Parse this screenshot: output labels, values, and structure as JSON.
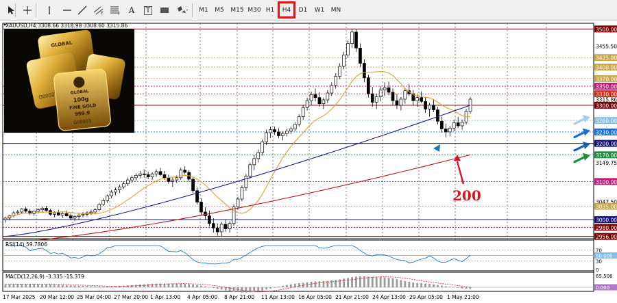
{
  "toolbar": {
    "tools": [
      {
        "name": "cursor-icon"
      },
      {
        "name": "crosshair-icon"
      },
      {
        "name": "vertical-line-icon"
      },
      {
        "name": "horizontal-line-icon"
      },
      {
        "name": "trendline-icon"
      },
      {
        "name": "equidistant-channel-icon"
      },
      {
        "name": "fibonacci-icon"
      },
      {
        "name": "text-icon",
        "label": "A"
      },
      {
        "name": "text-label-icon",
        "label": "T"
      },
      {
        "name": "rectangle-icon"
      },
      {
        "name": "shapes-icon"
      }
    ],
    "timeframes": [
      "M1",
      "M5",
      "M15",
      "M30",
      "H1",
      "H4",
      "D1",
      "W1",
      "MN"
    ],
    "active_timeframe": "H4"
  },
  "chart_header": "XAUUSD,H4  3308.66  3318.98  3308.60  3315.86",
  "photo_text": {
    "brand": "GLOBAL",
    "weight": "100g",
    "kind": "FINE GOLD",
    "purity": "999.9",
    "serial1": "G00023",
    "serial2": "G00003"
  },
  "price_axis": {
    "labels": [
      {
        "v": 3500.0,
        "text": "3500.00",
        "bg": "#7a0000",
        "fg": "#ffffff"
      },
      {
        "v": 3455.5,
        "text": "3455.50",
        "bg": "",
        "fg": "#000000"
      },
      {
        "v": 3425.0,
        "text": "3425.00",
        "bg": "#c8a84a",
        "fg": "#ffffff"
      },
      {
        "v": 3400.0,
        "text": "3400.00",
        "bg": "#c8a84a",
        "fg": "#ffffff"
      },
      {
        "v": 3370.0,
        "text": "3370.00",
        "bg": "#c8a84a",
        "fg": "#ffffff"
      },
      {
        "v": 3350.0,
        "text": "3350.00",
        "bg": "#c01e78",
        "fg": "#ffffff"
      },
      {
        "v": 3330.0,
        "text": "3330.00",
        "bg": "#d02a1c",
        "fg": "#ffffff"
      },
      {
        "v": 3315.86,
        "text": "3315.86",
        "bg": "",
        "fg": "#000000"
      },
      {
        "v": 3300.0,
        "text": "3300.00",
        "bg": "#7a0000",
        "fg": "#ffffff"
      },
      {
        "v": 3260.0,
        "text": "3260.00",
        "bg": "#87bde6",
        "fg": "#ffffff"
      },
      {
        "v": 3230.0,
        "text": "3230.00",
        "bg": "#1b6fd0",
        "fg": "#ffffff"
      },
      {
        "v": 3200.0,
        "text": "3200.00",
        "bg": "#101070",
        "fg": "#ffffff"
      },
      {
        "v": 3170.0,
        "text": "3170.00",
        "bg": "#1f8e3a",
        "fg": "#ffffff"
      },
      {
        "v": 3149.75,
        "text": "3149.75",
        "bg": "",
        "fg": "#000000"
      },
      {
        "v": 3100.0,
        "text": "3100.00",
        "bg": "#c01e78",
        "fg": "#ffffff"
      },
      {
        "v": 3047.5,
        "text": "3047.50",
        "bg": "",
        "fg": "#000000"
      },
      {
        "v": 3035.0,
        "text": "3035.00",
        "bg": "#c8a84a",
        "fg": "#ffffff"
      },
      {
        "v": 3000.0,
        "text": "3000.00",
        "bg": "#101070",
        "fg": "#ffffff"
      },
      {
        "v": 2980.0,
        "text": "2980.00",
        "bg": "#7a0000",
        "fg": "#ffffff"
      },
      {
        "v": 2956.0,
        "text": "2956.00",
        "bg": "#7a0000",
        "fg": "#ffffff"
      }
    ]
  },
  "h_levels": [
    {
      "v": 3500,
      "color": "#7a0000",
      "style": "solid"
    },
    {
      "v": 3425,
      "color": "#c8a84a",
      "style": "dot"
    },
    {
      "v": 3400,
      "color": "#c8a84a",
      "style": "dot"
    },
    {
      "v": 3370,
      "color": "#c8a84a",
      "style": "dot"
    },
    {
      "v": 3350,
      "color": "#c01e78",
      "style": "dot"
    },
    {
      "v": 3330,
      "color": "#d02a1c",
      "style": "dot"
    },
    {
      "v": 3300,
      "color": "#7a0000",
      "style": "solid"
    },
    {
      "v": 3260,
      "color": "#87bde6",
      "style": "dot"
    },
    {
      "v": 3230,
      "color": "#1b6fd0",
      "style": "dot"
    },
    {
      "v": 3200,
      "color": "#101070",
      "style": "solid"
    },
    {
      "v": 3170,
      "color": "#1f8e3a",
      "style": "dot"
    },
    {
      "v": 3100,
      "color": "#c01e78",
      "style": "dot"
    },
    {
      "v": 3035,
      "color": "#c8a84a",
      "style": "dot"
    },
    {
      "v": 3000,
      "color": "#101070",
      "style": "solid"
    },
    {
      "v": 2980,
      "color": "#7a0000",
      "style": "dot"
    },
    {
      "v": 2956,
      "color": "#7a0000",
      "style": "solid"
    }
  ],
  "annotation": {
    "text": "200",
    "color": "#d8161b"
  },
  "rsi": {
    "label": "RSI(14) 59.7806",
    "levels": [
      70,
      50,
      30,
      0
    ],
    "level_labels": [
      "70",
      "50.000",
      "30",
      "0"
    ]
  },
  "macd": {
    "label": "MACD(12,26,9) -3.335 -15.379",
    "axis_labels": [
      "65.506",
      "0.000"
    ]
  },
  "time_axis": [
    "17 Mar 2025",
    "20 Mar 12:00",
    "25 Mar 04:00",
    "27 Mar 20:00",
    "1 Apr 13:00",
    "4 Apr 05:00",
    "8 Apr 21:00",
    "11 Apr 13:00",
    "16 Apr 05:00",
    "21 Apr 21:00",
    "24 Apr 13:00",
    "29 Apr 05:00",
    "1 May 21:00"
  ],
  "chart_data": {
    "type": "candlestick",
    "symbol": "XAUUSD",
    "timeframe": "H4",
    "ylim": [
      2950,
      3515
    ],
    "candles": [
      [
        3000,
        3008,
        2992,
        3004
      ],
      [
        3004,
        3012,
        2998,
        3010
      ],
      [
        3010,
        3022,
        3006,
        3018
      ],
      [
        3018,
        3026,
        3012,
        3020
      ],
      [
        3020,
        3030,
        3015,
        3028
      ],
      [
        3028,
        3034,
        3018,
        3022
      ],
      [
        3022,
        3028,
        3012,
        3016
      ],
      [
        3016,
        3024,
        3010,
        3022
      ],
      [
        3022,
        3030,
        3016,
        3026
      ],
      [
        3026,
        3034,
        3020,
        3030
      ],
      [
        3030,
        3036,
        3020,
        3024
      ],
      [
        3024,
        3028,
        3010,
        3014
      ],
      [
        3014,
        3022,
        3006,
        3018
      ],
      [
        3018,
        3026,
        3010,
        3012
      ],
      [
        3012,
        3020,
        3004,
        3016
      ],
      [
        3016,
        3024,
        3008,
        3010
      ],
      [
        3010,
        3016,
        2998,
        3004
      ],
      [
        3004,
        3012,
        2996,
        3008
      ],
      [
        3008,
        3016,
        3000,
        3012
      ],
      [
        3012,
        3020,
        3006,
        3014
      ],
      [
        3014,
        3022,
        3008,
        3018
      ],
      [
        3018,
        3026,
        3012,
        3020
      ],
      [
        3020,
        3030,
        3014,
        3026
      ],
      [
        3026,
        3044,
        3022,
        3040
      ],
      [
        3040,
        3056,
        3036,
        3050
      ],
      [
        3050,
        3066,
        3044,
        3062
      ],
      [
        3062,
        3078,
        3056,
        3072
      ],
      [
        3072,
        3084,
        3064,
        3078
      ],
      [
        3078,
        3092,
        3070,
        3086
      ],
      [
        3086,
        3100,
        3080,
        3094
      ],
      [
        3094,
        3110,
        3088,
        3104
      ],
      [
        3104,
        3116,
        3096,
        3110
      ],
      [
        3110,
        3122,
        3102,
        3116
      ],
      [
        3116,
        3128,
        3108,
        3120
      ],
      [
        3120,
        3132,
        3110,
        3118
      ],
      [
        3118,
        3126,
        3106,
        3112
      ],
      [
        3112,
        3124,
        3104,
        3120
      ],
      [
        3120,
        3132,
        3112,
        3126
      ],
      [
        3126,
        3136,
        3114,
        3118
      ],
      [
        3118,
        3128,
        3104,
        3110
      ],
      [
        3110,
        3118,
        3094,
        3100
      ],
      [
        3100,
        3110,
        3086,
        3104
      ],
      [
        3104,
        3116,
        3096,
        3110
      ],
      [
        3110,
        3136,
        3104,
        3130
      ],
      [
        3130,
        3140,
        3118,
        3124
      ],
      [
        3124,
        3130,
        3100,
        3106
      ],
      [
        3106,
        3110,
        3070,
        3076
      ],
      [
        3076,
        3084,
        3040,
        3046
      ],
      [
        3046,
        3056,
        3012,
        3020
      ],
      [
        3020,
        3032,
        3000,
        3010
      ],
      [
        3010,
        3024,
        2982,
        2990
      ],
      [
        2990,
        3004,
        2966,
        2978
      ],
      [
        2978,
        2990,
        2958,
        2968
      ],
      [
        2968,
        2994,
        2956,
        2988
      ],
      [
        2988,
        3000,
        2968,
        2976
      ],
      [
        2976,
        2996,
        2966,
        2990
      ],
      [
        2990,
        3040,
        2984,
        3034
      ],
      [
        3034,
        3060,
        3026,
        3054
      ],
      [
        3054,
        3090,
        3048,
        3084
      ],
      [
        3084,
        3120,
        3076,
        3114
      ],
      [
        3114,
        3150,
        3108,
        3144
      ],
      [
        3144,
        3170,
        3130,
        3160
      ],
      [
        3160,
        3184,
        3150,
        3176
      ],
      [
        3176,
        3210,
        3168,
        3204
      ],
      [
        3204,
        3236,
        3196,
        3228
      ],
      [
        3228,
        3244,
        3214,
        3236
      ],
      [
        3236,
        3244,
        3222,
        3230
      ],
      [
        3230,
        3240,
        3214,
        3220
      ],
      [
        3220,
        3232,
        3208,
        3226
      ],
      [
        3226,
        3238,
        3218,
        3232
      ],
      [
        3232,
        3244,
        3224,
        3238
      ],
      [
        3238,
        3256,
        3232,
        3250
      ],
      [
        3250,
        3276,
        3244,
        3270
      ],
      [
        3270,
        3300,
        3262,
        3294
      ],
      [
        3294,
        3320,
        3286,
        3312
      ],
      [
        3312,
        3336,
        3300,
        3328
      ],
      [
        3328,
        3344,
        3310,
        3320
      ],
      [
        3320,
        3334,
        3296,
        3304
      ],
      [
        3304,
        3320,
        3290,
        3314
      ],
      [
        3314,
        3340,
        3306,
        3332
      ],
      [
        3332,
        3360,
        3324,
        3352
      ],
      [
        3352,
        3384,
        3344,
        3376
      ],
      [
        3376,
        3410,
        3368,
        3402
      ],
      [
        3402,
        3440,
        3394,
        3432
      ],
      [
        3432,
        3470,
        3424,
        3462
      ],
      [
        3462,
        3500,
        3450,
        3492
      ],
      [
        3492,
        3500,
        3440,
        3450
      ],
      [
        3450,
        3462,
        3400,
        3410
      ],
      [
        3410,
        3420,
        3360,
        3372
      ],
      [
        3372,
        3380,
        3320,
        3330
      ],
      [
        3330,
        3348,
        3296,
        3308
      ],
      [
        3308,
        3330,
        3290,
        3322
      ],
      [
        3322,
        3350,
        3310,
        3340
      ],
      [
        3340,
        3360,
        3324,
        3346
      ],
      [
        3346,
        3362,
        3326,
        3334
      ],
      [
        3334,
        3344,
        3300,
        3312
      ],
      [
        3312,
        3330,
        3290,
        3300
      ],
      [
        3300,
        3322,
        3286,
        3316
      ],
      [
        3316,
        3344,
        3304,
        3338
      ],
      [
        3338,
        3356,
        3324,
        3330
      ],
      [
        3330,
        3340,
        3300,
        3312
      ],
      [
        3312,
        3328,
        3296,
        3320
      ],
      [
        3320,
        3336,
        3306,
        3310
      ],
      [
        3310,
        3322,
        3280,
        3290
      ],
      [
        3290,
        3306,
        3270,
        3300
      ],
      [
        3300,
        3316,
        3282,
        3288
      ],
      [
        3288,
        3296,
        3250,
        3258
      ],
      [
        3258,
        3270,
        3228,
        3238
      ],
      [
        3238,
        3252,
        3216,
        3230
      ],
      [
        3230,
        3246,
        3218,
        3240
      ],
      [
        3240,
        3262,
        3232,
        3254
      ],
      [
        3254,
        3270,
        3240,
        3246
      ],
      [
        3246,
        3262,
        3236,
        3256
      ],
      [
        3256,
        3290,
        3250,
        3284
      ],
      [
        3284,
        3322,
        3278,
        3315.86
      ]
    ],
    "moving_averages": [
      {
        "name": "MA50",
        "color": "#e0a030"
      },
      {
        "name": "MA100",
        "color": "#1a1a8c"
      },
      {
        "name": "MA200",
        "color": "#b01818"
      }
    ]
  }
}
